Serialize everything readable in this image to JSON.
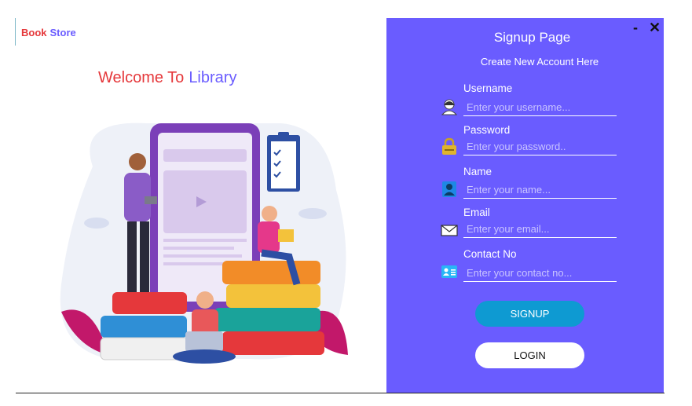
{
  "brand": {
    "part1": "Book",
    "part2": "Store"
  },
  "welcome": {
    "part1": "Welcome To",
    "part2": "Library"
  },
  "window_controls": {
    "minimize": "-",
    "close": "✕"
  },
  "signup": {
    "title": "Signup Page",
    "subtitle": "Create New Account Here",
    "fields": {
      "username": {
        "label": "Username",
        "placeholder": "Enter your username...",
        "value": ""
      },
      "password": {
        "label": "Password",
        "placeholder": "Enter your password..",
        "value": ""
      },
      "name": {
        "label": "Name",
        "placeholder": "Enter your name...",
        "value": ""
      },
      "email": {
        "label": "Email",
        "placeholder": "Enter your email...",
        "value": ""
      },
      "contact": {
        "label": "Contact No",
        "placeholder": "Enter your contact no...",
        "value": ""
      }
    },
    "signup_label": "SIGNUP",
    "login_label": "LOGIN"
  },
  "colors": {
    "panel": "#6a5cff",
    "accent_red": "#e5383b",
    "signup_button": "#0e9ad2"
  }
}
